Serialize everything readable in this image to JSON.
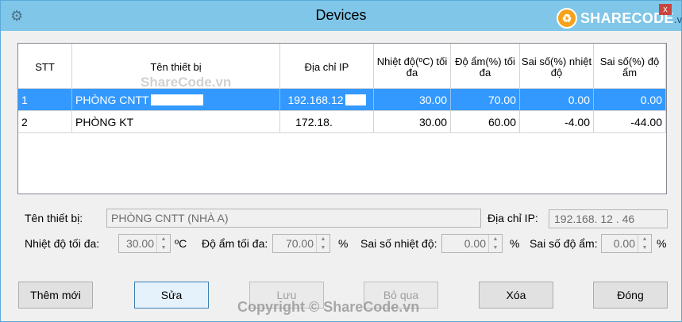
{
  "window": {
    "title": "Devices",
    "brand": "SHARECODE",
    "brand_domain": ".vn",
    "close_glyph": "x"
  },
  "grid": {
    "headers": [
      "STT",
      "Tên thiết bị",
      "Địa chỉ IP",
      "Nhiệt độ(ºC) tối đa",
      "Độ ẩm(%) tối đa",
      "Sai số(%) nhiệt độ",
      "Sai số(%) độ ẩm"
    ],
    "rows": [
      {
        "stt": "1",
        "name": "PHÒNG CNTT",
        "ip": "192.168.12",
        "temp_max": "30.00",
        "hum_max": "70.00",
        "temp_err": "0.00",
        "hum_err": "0.00",
        "selected": true
      },
      {
        "stt": "2",
        "name": "PHÒNG KT",
        "ip": "172.18.",
        "temp_max": "30.00",
        "hum_max": "60.00",
        "temp_err": "-4.00",
        "hum_err": "-44.00",
        "selected": false
      }
    ],
    "watermark": "ShareCode.vn"
  },
  "form": {
    "name_label": "Tên thiết bị:",
    "name_value": "PHÒNG CNTT (NHÀ A)",
    "ip_label": "Địa chỉ IP:",
    "ip_value": "192.168. 12 . 46",
    "temp_max_label": "Nhiệt độ tối đa:",
    "temp_max_value": "30.00",
    "temp_unit": "ºC",
    "hum_max_label": "Độ ẩm tối đa:",
    "hum_max_value": "70.00",
    "hum_unit": "%",
    "temp_err_label": "Sai số nhiệt độ:",
    "temp_err_value": "0.00",
    "temp_err_unit": "%",
    "hum_err_label": "Sai số độ ẩm:",
    "hum_err_value": "0.00",
    "hum_err_unit": "%"
  },
  "buttons": {
    "add": "Thêm mới",
    "edit": "Sửa",
    "save": "Lưu",
    "skip": "Bỏ qua",
    "delete": "Xóa",
    "close": "Đóng"
  },
  "footer_watermark": "Copyright © ShareCode.vn"
}
